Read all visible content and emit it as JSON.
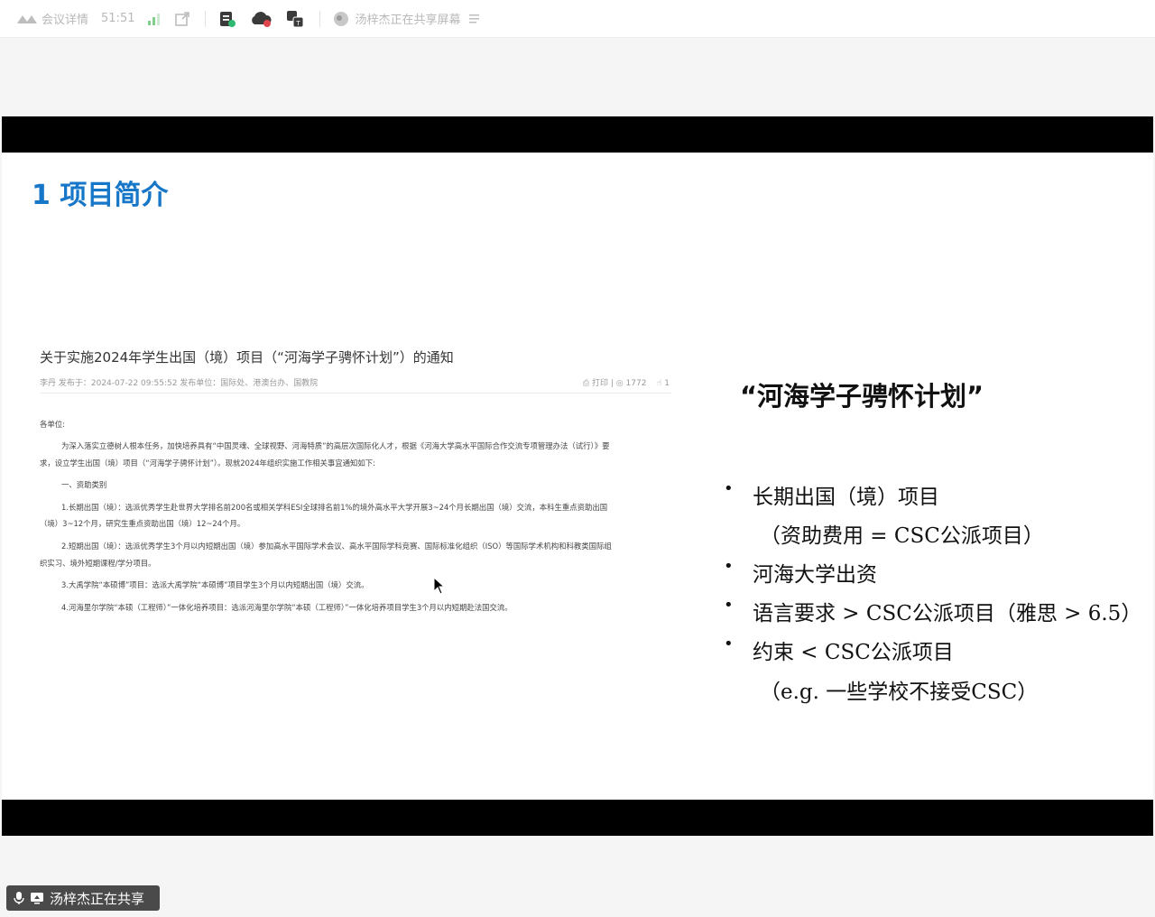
{
  "toolbar": {
    "meeting_details": "会议详情",
    "timer": "51:51",
    "presenter_status": "汤梓杰正在共享屏幕"
  },
  "slide": {
    "title": "1 项目简介",
    "notice": {
      "title": "关于实施2024年学生出国（境）项目（“河海学子骋怀计划”）的通知",
      "meta": "李丹  发布于：2024-07-22 09:55:52      发布单位：国际处、港澳台办、国教院",
      "print_label": "打印",
      "views": "1772",
      "likes": "1",
      "lines": [
        "各单位:",
        "为深入落实立德树人根本任务，加快培养具有“中国灵魂、全球视野、河海特质”的高层次国际化人才，根据《河海大学高水平国际合作交流专项管理办法（试行）》要",
        "求，设立学生出国（境）项目（“河海学子骋怀计划”）。现就2024年组织实施工作相关事宜通知如下:",
        "一、资助类别",
        "1.长期出国（境）：选派优秀学生赴世界大学排名前200名或相关学科ESI全球排名前1%的境外高水平大学开展3~24个月长期出国（境）交流，本科生重点资助出国",
        "（境）3~12个月，研究生重点资助出国（境）12~24个月。",
        "2.短期出国（境）：选派优秀学生3个月以内短期出国（境）参加高水平国际学术会议、高水平国际学科竞赛、国际标准化组织（ISO）等国际学术机构和科教类国际组",
        "织实习、境外短期课程/学分项目。",
        "3.大禹学院“本硕博”项目：选派大禹学院“本硕博”项目学生3个月以内短期出国（境）交流。",
        "4.河海里尔学院“本硕（工程师）”一体化培养项目：选派河海里尔学院“本硕（工程师）”一体化培养项目学生3个月以内短期赴法国交流。"
      ]
    },
    "plan_title": "“河海学子骋怀计划”",
    "bullets": [
      {
        "text": "长期出国（境）项目",
        "dot": "•"
      },
      {
        "text": "（资助费用 = CSC公派项目）",
        "dot": ""
      },
      {
        "text": "河海大学出资",
        "dot": "•"
      },
      {
        "text": "语言要求 > CSC公派项目（雅思 > 6.5）",
        "dot": "•"
      },
      {
        "text": "约束 < CSC公派项目",
        "dot": "•"
      },
      {
        "text": "（e.g. 一些学校不接受CSC）",
        "dot": ""
      }
    ]
  },
  "sharing_badge": "汤梓杰正在共享",
  "colors": {
    "slide_title": "#1677c8",
    "letterbox": "#000000",
    "badge_bg": "#4a4a4a"
  }
}
